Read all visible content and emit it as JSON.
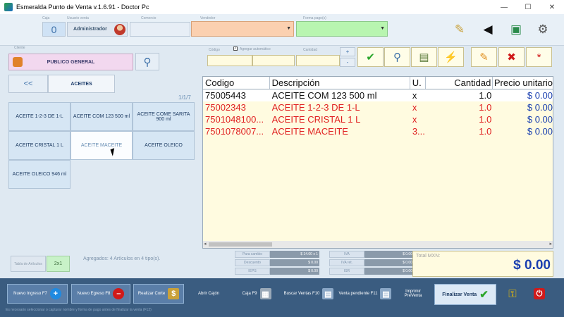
{
  "window": {
    "title": "Esmeralda Punto de Venta v.1.6.91 - Doctor Pc",
    "minimize": "—",
    "maximize": "☐",
    "close": "✕"
  },
  "topbar": {
    "caja_label": "Caja",
    "caja_value": "0",
    "usuario_label": "Usuario venta",
    "usuario_value": "Administrador",
    "cliente_label": "Comercio",
    "vendedor_label": "Vendedor",
    "pago_label": "Forma pago(s)"
  },
  "cliente": {
    "label": "Cliente",
    "value": "PUBLICO GENERAL"
  },
  "catalog": {
    "back": "<<",
    "category": "ACEITES",
    "pager": "1/1/7",
    "products": [
      "ACEITE 1-2-3 DE 1-L",
      "ACEITE COM 123 500 ml",
      "ACEITE COME SARITA 900 ml",
      "ACEITE CRISTAL 1 L",
      "ACEITE MACEITE",
      "ACEITE OLEICO",
      "ACEITE OLEICO 946 ml"
    ]
  },
  "qty": {
    "codigo_label": "Código",
    "auto_label": "Agregar automático",
    "cantidad_label": "Cantidad",
    "plus": "+",
    "minus": "-"
  },
  "table": {
    "headers": [
      "Codigo",
      "Descripción",
      "U.",
      "Cantidad",
      "Precio unitario"
    ],
    "rows": [
      {
        "codigo": "75005443",
        "descripcion": "ACEITE COM 123 500 ml",
        "u": "x",
        "cantidad": "1.0",
        "precio": "$ 0.00",
        "color": "#111111"
      },
      {
        "codigo": "75002343",
        "descripcion": "ACEITE 1-2-3 DE 1-L",
        "u": "x",
        "cantidad": "1.0",
        "precio": "$ 0.00",
        "color": "#e02020"
      },
      {
        "codigo": "7501048100...",
        "descripcion": "ACEITE CRISTAL 1 L",
        "u": "x",
        "cantidad": "1.0",
        "precio": "$ 0.00",
        "color": "#e02020"
      },
      {
        "codigo": "7501078007...",
        "descripcion": "ACEITE MACEITE",
        "u": "3...",
        "cantidad": "1.0",
        "precio": "$ 0.00",
        "color": "#e02020"
      }
    ],
    "scroll_left": "◂",
    "scroll_right": "▸"
  },
  "bottom_left": {
    "tabla": "Tabla de Artículos",
    "dos_por_uno": "2x1",
    "agregados": "Agregados: 4 Artículos en 4 tipo(s)."
  },
  "totals": {
    "rows": [
      {
        "k1": "Para cambio",
        "v1": "$ 14.00 x 1",
        "k2": "IVA",
        "v2": "$ 0.00"
      },
      {
        "k1": "Descuento",
        "v1": "$ 0.00",
        "k2": "IVA ret.",
        "v2": "$ 0.00"
      },
      {
        "k1": "IEPS",
        "v1": "$ 0.00",
        "k2": "ISR",
        "v2": "$ 0.00"
      }
    ],
    "total_label": "Total MXN:",
    "total_value": "$ 0.00"
  },
  "bottombar": {
    "nuevo_ingreso": "Nuevo Ingreso F7",
    "nuevo_egreso": "Nuevo Egreso F8",
    "realizar_corte": "Realizar Corte",
    "abrir_cajon": "Abrir Cajón",
    "caja": "Caja F9",
    "buscar_ventas": "Buscar Ventas F10",
    "venta_pendiente": "Venta pendiente F11",
    "imprimir": "Imprimir PreVenta",
    "finalizar": "Finalizar Venta",
    "status": "Es necesario seleccionar o capturar nombre y forma de pago antes de finalizar la venta (F12)"
  }
}
